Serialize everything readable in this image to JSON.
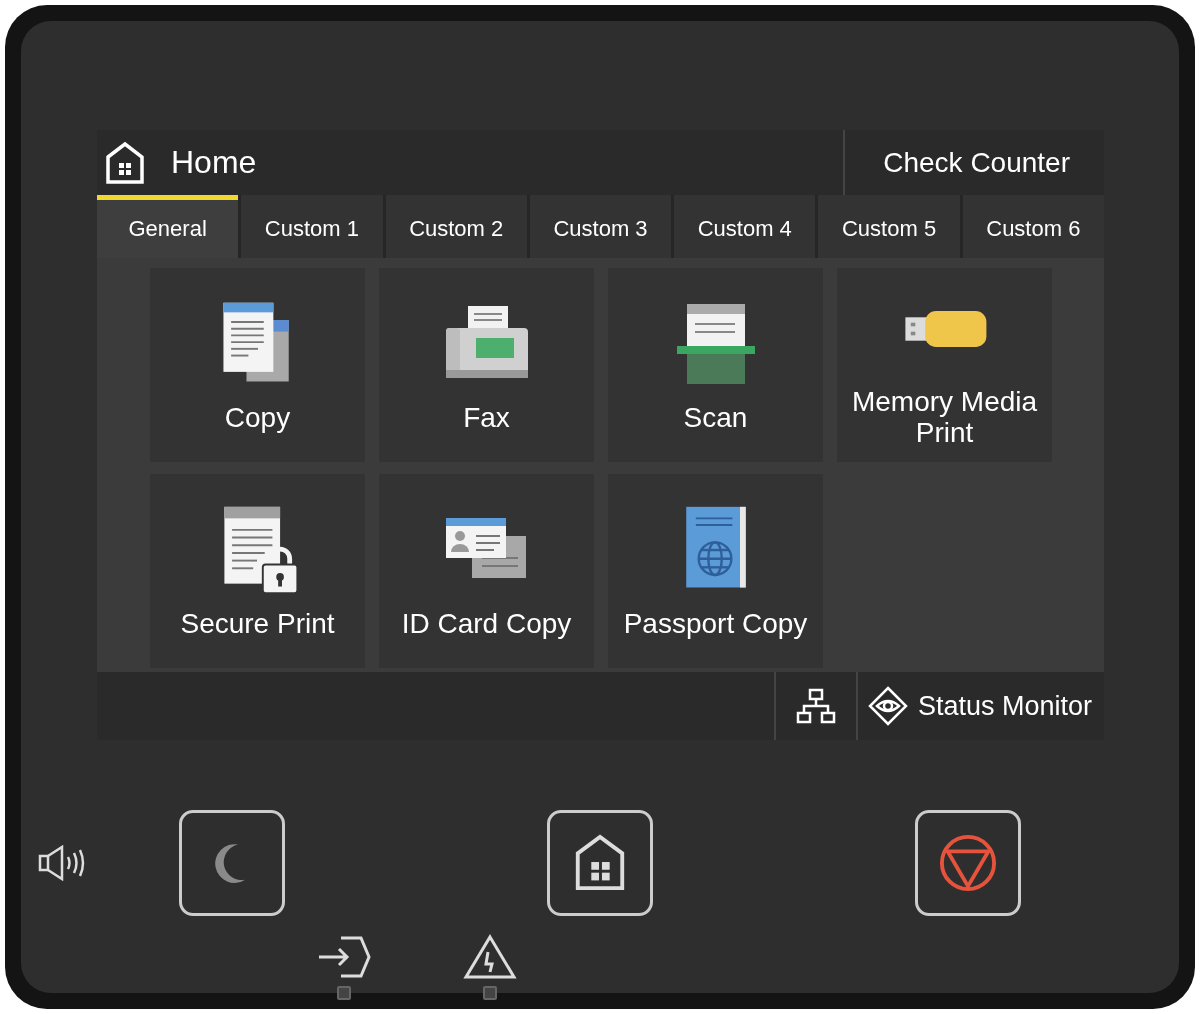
{
  "header": {
    "title": "Home",
    "counter_button": "Check Counter"
  },
  "tabs": [
    {
      "label": "General",
      "selected": true
    },
    {
      "label": "Custom 1",
      "selected": false
    },
    {
      "label": "Custom 2",
      "selected": false
    },
    {
      "label": "Custom 3",
      "selected": false
    },
    {
      "label": "Custom 4",
      "selected": false
    },
    {
      "label": "Custom 5",
      "selected": false
    },
    {
      "label": "Custom 6",
      "selected": false
    }
  ],
  "functions": [
    {
      "kind": "copy",
      "label": "Copy"
    },
    {
      "kind": "fax",
      "label": "Fax"
    },
    {
      "kind": "scan",
      "label": "Scan"
    },
    {
      "kind": "memory",
      "label": "Memory Media Print"
    },
    {
      "kind": "secure",
      "label": "Secure Print"
    },
    {
      "kind": "idcard",
      "label": "ID Card Copy"
    },
    {
      "kind": "passport",
      "label": "Passport Copy"
    }
  ],
  "status_bar": {
    "status_button": "Status Monitor"
  }
}
